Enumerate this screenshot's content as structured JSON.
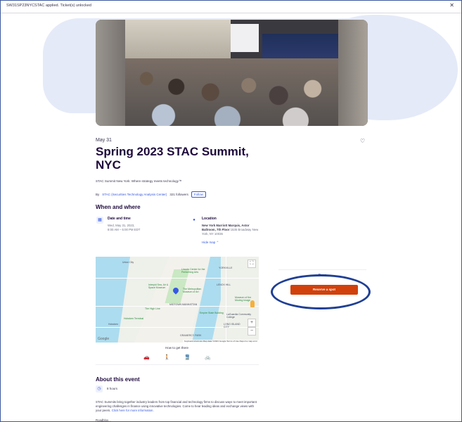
{
  "banner": {
    "message": "SW31SP23NYCSTAC applied. Ticket(s) unlocked",
    "close_icon": "close-icon"
  },
  "event": {
    "date": "May 31",
    "title": "Spring 2023 STAC Summit, NYC",
    "summary": "STAC Summit New York: Where strategy meets technology™",
    "organizer_prefix": "By",
    "organizer": "STAC (Securities Technology Analysis Center)",
    "followers": "321 followers",
    "follow_label": "Follow"
  },
  "when_where": {
    "heading": "When and where",
    "date_title": "Date and time",
    "date_line1": "Wed, May 31, 2023,",
    "date_line2": "8:00 AM – 5:00 PM EDT",
    "location_title": "Location",
    "location_bold1": "New York Marriott Marquis, Astor",
    "location_bold2": "Ballroom, 7th Floor",
    "location_rest": "1535 Broadway New",
    "location_line3": "York, NY 10036",
    "hide_map": "Hide map ⌃"
  },
  "map": {
    "labels": {
      "union_city": "Union City",
      "yorkville": "YORKVILLE",
      "lincoln": "Lincoln Center for the Performing Arts",
      "lenox": "LENOX HILL",
      "intrepid": "Intrepid Sea, Air & Space Museum",
      "met": "The Metropolitan Museum of Art",
      "museum_moving": "Museum of the Moving Image",
      "midtown": "MIDTOWN MANHATTAN",
      "high_line": "The High Line",
      "empire": "Empire State Building",
      "laguardia": "LaGuardia Community College",
      "hoboken": "Hoboken",
      "terminal": "Hoboken Terminal",
      "lic": "LONG ISLAND CITY",
      "gramercy": "GRAMERCY PARK",
      "google": "Google",
      "attribution": "Keyboard shortcuts   Map data ©2023 Google   Terms of Use   Report a map error"
    },
    "fullscreen_label": "⛶",
    "zoom_in_label": "+",
    "zoom_out_label": "−"
  },
  "travel": {
    "heading": "How to get there",
    "modes": [
      {
        "icon": "car-icon",
        "glyph": "🚗"
      },
      {
        "icon": "walk-icon",
        "glyph": "🚶"
      },
      {
        "icon": "transit-icon",
        "glyph": "🚆"
      },
      {
        "icon": "bike-icon",
        "glyph": "🚲"
      }
    ]
  },
  "about": {
    "heading": "About this event",
    "duration": "8 hours",
    "description": "STAC Summits bring together industry leaders from top financial and technology firms to discuss ways to meet important engineering challenges in finance using innovative technologies. Come to hear leading ideas and exchange views with your peers.",
    "link_text": "Click here for more information.",
    "more": "Roadblox..."
  },
  "ticket": {
    "price": "Free",
    "button_label": "Reserve a spot"
  },
  "colors": {
    "accent": "#3659e3",
    "cta": "#d1410c",
    "annotation": "#1f3f94"
  }
}
